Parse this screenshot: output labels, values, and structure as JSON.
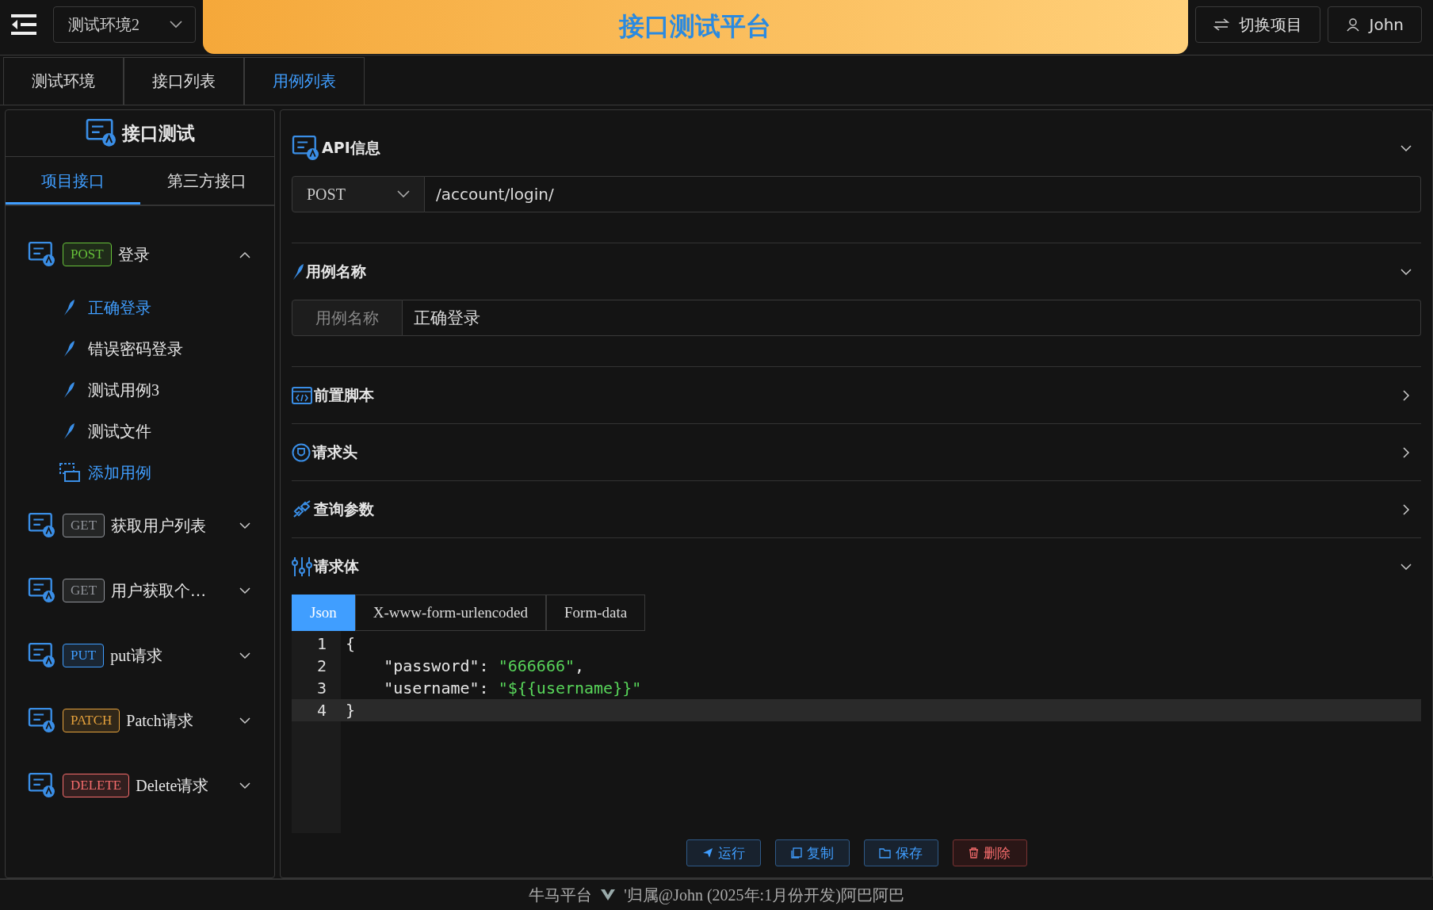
{
  "header": {
    "env_select": "测试环境2",
    "title": "接口测试平台",
    "buttons": [
      {
        "label": "切换项目",
        "kind": "switch"
      },
      {
        "label": "John",
        "kind": "user"
      }
    ]
  },
  "tabs": [
    {
      "label": "测试环境",
      "selected": false
    },
    {
      "label": "接口列表",
      "selected": false
    },
    {
      "label": "用例列表",
      "selected": true
    }
  ],
  "sidebar": {
    "title": "接口测试",
    "tabs": [
      {
        "label": "项目接口",
        "selected": true
      },
      {
        "label": "第三方接口",
        "selected": false
      }
    ],
    "apis": [
      {
        "method": "POST",
        "color": "#67c23a",
        "name": "登录",
        "expanded": true,
        "add_label": "添加用例",
        "cases": [
          {
            "name": "正确登录",
            "selected": true
          },
          {
            "name": "错误密码登录",
            "selected": false
          },
          {
            "name": "测试用例3",
            "selected": false
          },
          {
            "name": "测试文件",
            "selected": false
          }
        ]
      },
      {
        "method": "GET",
        "color": "#909399",
        "name": "获取用户列表",
        "expanded": false
      },
      {
        "method": "GET",
        "color": "#909399",
        "name": "用户获取个…",
        "expanded": false
      },
      {
        "method": "PUT",
        "color": "#409eff",
        "name": "put请求",
        "expanded": false
      },
      {
        "method": "PATCH",
        "color": "#e6a23c",
        "name": "Patch请求",
        "expanded": false
      },
      {
        "method": "DELETE",
        "color": "#f56c6c",
        "name": "Delete请求",
        "expanded": false
      }
    ]
  },
  "main": {
    "sections": [
      {
        "kind": "api",
        "title": "API信息",
        "expanded": true,
        "method": "POST",
        "url": "/account/login/"
      },
      {
        "kind": "name",
        "title": "用例名称",
        "expanded": true,
        "label": "用例名称",
        "value": "正确登录"
      },
      {
        "kind": "script",
        "title": "前置脚本",
        "expanded": false
      },
      {
        "kind": "headers",
        "title": "请求头",
        "expanded": false
      },
      {
        "kind": "params",
        "title": "查询参数",
        "expanded": false
      },
      {
        "kind": "body",
        "title": "请求体",
        "expanded": true,
        "tabs": [
          {
            "label": "Json",
            "selected": true
          },
          {
            "label": "X-www-form-urlencoded",
            "selected": false
          },
          {
            "label": "Form-data",
            "selected": false
          }
        ],
        "code": [
          {
            "number": "1",
            "current": false,
            "tokens": [
              {
                "text": "{",
                "kind": "punct"
              }
            ]
          },
          {
            "number": "2",
            "current": false,
            "tokens": [
              {
                "text": "    \"password\"",
                "kind": "key"
              },
              {
                "text": ": ",
                "kind": "punct"
              },
              {
                "text": "\"666666\"",
                "kind": "string"
              },
              {
                "text": ",",
                "kind": "punct"
              }
            ]
          },
          {
            "number": "3",
            "current": false,
            "tokens": [
              {
                "text": "    \"username\"",
                "kind": "key"
              },
              {
                "text": ": ",
                "kind": "punct"
              },
              {
                "text": "\"${{username}}\"",
                "kind": "string"
              }
            ]
          },
          {
            "number": "4",
            "current": true,
            "tokens": [
              {
                "text": "}",
                "kind": "punct"
              }
            ]
          }
        ],
        "actions": [
          {
            "label": "运行",
            "kind": "run"
          },
          {
            "label": "复制",
            "kind": "copy"
          },
          {
            "label": "保存",
            "kind": "save"
          },
          {
            "label": "删除",
            "kind": "delete"
          }
        ]
      }
    ]
  },
  "footer": {
    "left": "牛马平台",
    "right": "'归属@John (2025年:1月份开发)阿巴阿巴"
  }
}
